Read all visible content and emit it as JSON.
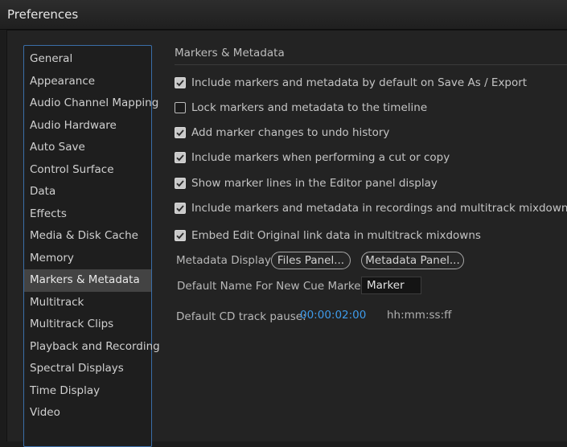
{
  "window": {
    "title": "Preferences"
  },
  "sidebar": {
    "items": [
      {
        "label": "General",
        "selected": false
      },
      {
        "label": "Appearance",
        "selected": false
      },
      {
        "label": "Audio Channel Mapping",
        "selected": false
      },
      {
        "label": "Audio Hardware",
        "selected": false
      },
      {
        "label": "Auto Save",
        "selected": false
      },
      {
        "label": "Control Surface",
        "selected": false
      },
      {
        "label": "Data",
        "selected": false
      },
      {
        "label": "Effects",
        "selected": false
      },
      {
        "label": "Media & Disk Cache",
        "selected": false
      },
      {
        "label": "Memory",
        "selected": false
      },
      {
        "label": "Markers & Metadata",
        "selected": true
      },
      {
        "label": "Multitrack",
        "selected": false
      },
      {
        "label": "Multitrack Clips",
        "selected": false
      },
      {
        "label": "Playback and Recording",
        "selected": false
      },
      {
        "label": "Spectral Displays",
        "selected": false
      },
      {
        "label": "Time Display",
        "selected": false
      },
      {
        "label": "Video",
        "selected": false
      }
    ]
  },
  "panel": {
    "title": "Markers & Metadata",
    "options": [
      {
        "label": "Include markers and metadata by default on Save As / Export",
        "checked": true
      },
      {
        "label": "Lock markers and metadata to the timeline",
        "checked": false
      },
      {
        "label": "Add marker changes to undo history",
        "checked": true
      },
      {
        "label": "Include markers when performing a cut or copy",
        "checked": true
      },
      {
        "label": "Show marker lines in the Editor panel display",
        "checked": true
      },
      {
        "label": "Include markers and metadata in recordings and multitrack mixdowns",
        "checked": true
      },
      {
        "label": "Embed Edit Original link data in multitrack mixdowns",
        "checked": true
      }
    ],
    "metadata_display": {
      "label": "Metadata Display:",
      "files_button": "Files Panel...",
      "metadata_button": "Metadata Panel..."
    },
    "cue_marker": {
      "label": "Default Name For New Cue Markers:",
      "value": "Marker"
    },
    "cd_pause": {
      "label": "Default CD track pause:",
      "value": "00:00:02:00",
      "format": "hh:mm:ss:ff"
    }
  },
  "colors": {
    "accent": "#3e9bea",
    "selection": "#434343",
    "sidebar_border": "#3a6ea8"
  }
}
